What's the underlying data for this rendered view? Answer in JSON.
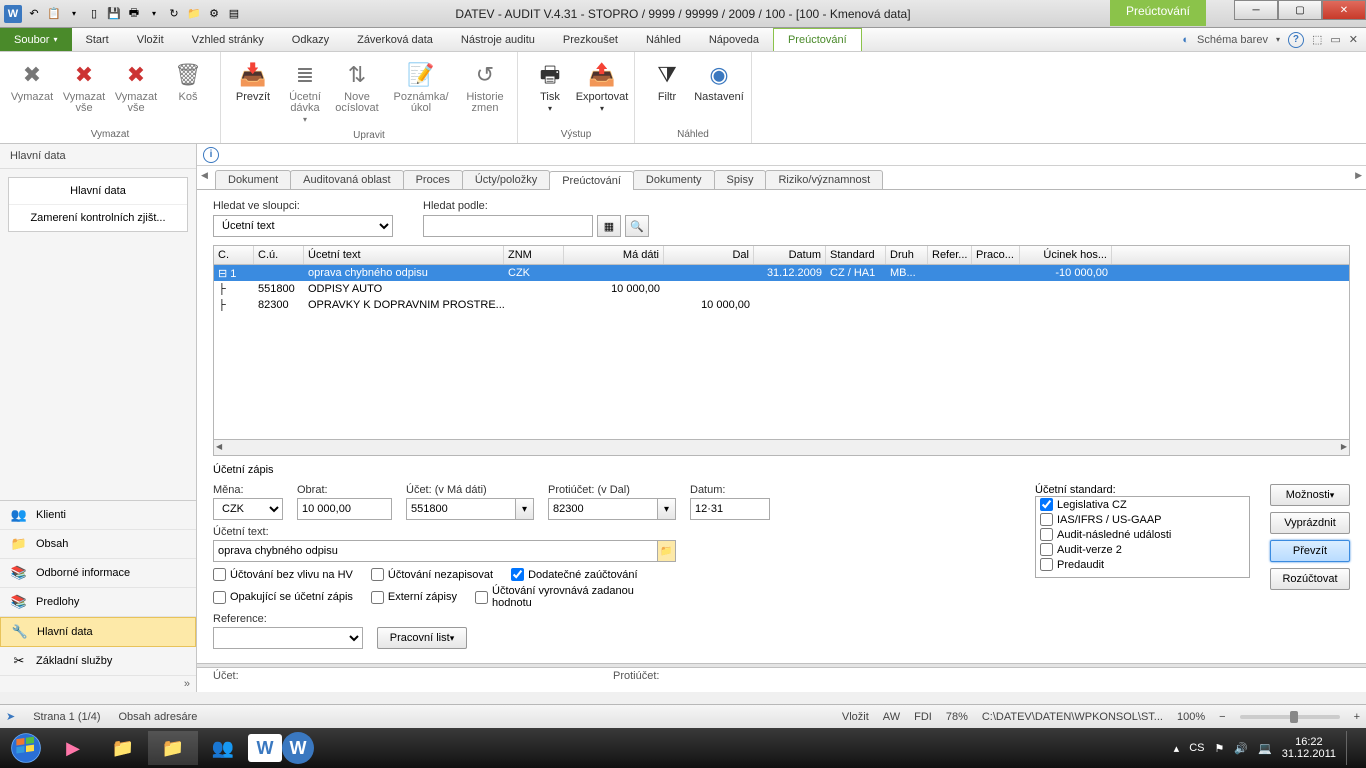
{
  "title": "DATEV - AUDIT V.4.31 - STOPRO / 9999 / 99999 / 2009 / 100  - [100 - Kmenová data]",
  "context_tab": "Preúctování",
  "menu": {
    "file": "Soubor",
    "items": [
      "Start",
      "Vložit",
      "Vzhled stránky",
      "Odkazy",
      "Záverková data",
      "Nástroje auditu",
      "Prezkoušet",
      "Náhled",
      "Nápoveda",
      "Preúctování"
    ],
    "scheme": "Schéma barev"
  },
  "ribbon": {
    "g1": {
      "name": "Vymazat",
      "b": [
        "Vymazat",
        "Vymazat vše",
        "Vymazat vše",
        "Koš"
      ]
    },
    "g2": {
      "name": "Upravit",
      "b": [
        "Prevzít",
        "Úcetní dávka",
        "Nove ocíslovat",
        "Poznámka/úkol",
        "Historie zmen"
      ]
    },
    "g3": {
      "name": "Výstup",
      "b": [
        "Tisk",
        "Exportovat"
      ]
    },
    "g4": {
      "name": "Náhled",
      "b": [
        "Filtr",
        "Nastavení"
      ]
    }
  },
  "left": {
    "head": "Hlavní data",
    "tree": [
      "Hlavní data",
      "Zamerení kontrolních zjišt..."
    ],
    "nav": [
      "Klienti",
      "Obsah",
      "Odborné informace",
      "Predlohy",
      "Hlavní data",
      "Základní služby"
    ]
  },
  "subtabs": [
    "Dokument",
    "Auditovaná oblast",
    "Proces",
    "Úcty/položky",
    "Preúctování",
    "Dokumenty",
    "Spisy",
    "Riziko/významnost"
  ],
  "filters": {
    "col_label": "Hledat ve sloupci:",
    "col_value": "Úcetní text",
    "search_label": "Hledat podle:",
    "search_value": ""
  },
  "grid": {
    "headers": [
      "C.",
      "C.ú.",
      "Úcetní text",
      "ZNM",
      "Má dáti",
      "Dal",
      "Datum",
      "Standard",
      "Druh",
      "Refer...",
      "Praco...",
      "Úcinek hos..."
    ],
    "rows": [
      {
        "c": "1",
        "cu": "",
        "txt": "oprava chybného odpisu",
        "znm": "CZK",
        "md": "",
        "dal": "",
        "dat": "31.12.2009",
        "std": "CZ / HA1",
        "dr": "MB...",
        "ref": "",
        "pr": "",
        "uh": "-10 000,00",
        "sel": true
      },
      {
        "c": "",
        "cu": "551800",
        "txt": "ODPISY AUTO",
        "znm": "",
        "md": "10 000,00",
        "dal": "",
        "dat": "",
        "std": "",
        "dr": "",
        "ref": "",
        "pr": "",
        "uh": ""
      },
      {
        "c": "",
        "cu": "82300",
        "txt": "OPRAVKY K DOPRAVNIM PROSTRE...",
        "znm": "",
        "md": "",
        "dal": "10 000,00",
        "dat": "",
        "std": "",
        "dr": "",
        "ref": "",
        "pr": "",
        "uh": ""
      }
    ]
  },
  "form": {
    "heading": "Účetní zápis",
    "mena_l": "Měna:",
    "mena_v": "CZK",
    "obrat_l": "Obrat:",
    "obrat_v": "10 000,00",
    "ucet_l": "Účet: (v Má dáti)",
    "ucet_v": "551800",
    "proti_l": "Protiúčet: (v Dal)",
    "proti_v": "82300",
    "datum_l": "Datum:",
    "datum_v": "12·31",
    "utext_l": "Účetní text:",
    "utext_v": "oprava chybného odpisu",
    "ustd_l": "Účetní standard:",
    "std_opts": [
      "Legislativa CZ",
      "IAS/IFRS / US-GAAP",
      "Audit-následné události",
      "Audit-verze 2",
      "Predaudit"
    ],
    "chk": [
      "Účtování bez vlivu na HV",
      "Účtování nezapisovat",
      "Dodatečné zaúčtování",
      "Opakující se účetní zápis",
      "Externí zápisy",
      "Účtování vyrovnává zadanou hodnotu"
    ],
    "ref_l": "Reference:",
    "pracovni": "Pracovní list",
    "btns": {
      "opt": "Možnosti",
      "clear": "Vyprázdnit",
      "take": "Převzít",
      "split": "Rozúčtovat"
    },
    "bottom": [
      "Účet:",
      "Protiúčet:"
    ]
  },
  "status": {
    "page": "Strana 1 (1/4)",
    "obsah": "Obsah adresáre",
    "right": [
      "Vložit",
      "AW",
      "FDI",
      "78%",
      "C:\\DATEV\\DATEN\\WPKONSOL\\ST...",
      "100%"
    ]
  },
  "taskbar": {
    "lang": "CS",
    "time": "16:22",
    "date": "31.12.2011"
  }
}
